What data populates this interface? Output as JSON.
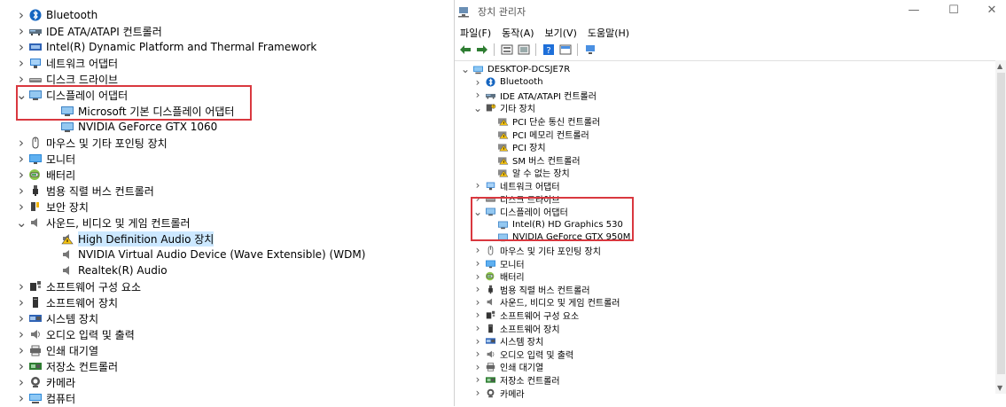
{
  "left": {
    "items": [
      {
        "chev": ">",
        "icon": "bluetooth-icon",
        "label": "Bluetooth",
        "level": 0
      },
      {
        "chev": ">",
        "icon": "drive-controller-icon",
        "label": "IDE ATA/ATAPI 컨트롤러",
        "level": 0
      },
      {
        "chev": ">",
        "icon": "chip-icon",
        "label": "Intel(R) Dynamic Platform and Thermal Framework",
        "level": 0
      },
      {
        "chev": ">",
        "icon": "network-icon",
        "label": "네트워크 어댑터",
        "level": 0
      },
      {
        "chev": ">",
        "icon": "disk-drive-icon",
        "label": "디스크 드라이브",
        "level": 0
      },
      {
        "chev": "v",
        "icon": "display-icon",
        "label": "디스플레이 어댑터",
        "level": 0
      },
      {
        "chev": "",
        "icon": "display-icon",
        "label": "Microsoft 기본 디스플레이 어댑터",
        "level": 1
      },
      {
        "chev": "",
        "icon": "display-icon",
        "label": "NVIDIA GeForce GTX 1060",
        "level": 1
      },
      {
        "chev": ">",
        "icon": "mouse-icon",
        "label": "마우스 및 기타 포인팅 장치",
        "level": 0
      },
      {
        "chev": ">",
        "icon": "monitor-icon",
        "label": "모니터",
        "level": 0
      },
      {
        "chev": ">",
        "icon": "battery-icon",
        "label": "배터리",
        "level": 0
      },
      {
        "chev": ">",
        "icon": "usb-icon",
        "label": "범용 직렬 버스 컨트롤러",
        "level": 0
      },
      {
        "chev": ">",
        "icon": "security-key-icon",
        "label": "보안 장치",
        "level": 0
      },
      {
        "chev": "v",
        "icon": "speaker-icon",
        "label": "사운드, 비디오 및 게임 컨트롤러",
        "level": 0
      },
      {
        "chev": "",
        "icon": "warning-speaker-icon",
        "label": "High Definition Audio 장치",
        "level": 1,
        "selected": true
      },
      {
        "chev": "",
        "icon": "speaker-icon",
        "label": "NVIDIA Virtual Audio Device (Wave Extensible) (WDM)",
        "level": 1
      },
      {
        "chev": "",
        "icon": "speaker-icon",
        "label": "Realtek(R) Audio",
        "level": 1
      },
      {
        "chev": ">",
        "icon": "software-component-icon",
        "label": "소프트웨어 구성 요소",
        "level": 0
      },
      {
        "chev": ">",
        "icon": "software-device-icon",
        "label": "소프트웨어 장치",
        "level": 0
      },
      {
        "chev": ">",
        "icon": "system-icon",
        "label": "시스템 장치",
        "level": 0
      },
      {
        "chev": ">",
        "icon": "audio-io-icon",
        "label": "오디오 입력 및 출력",
        "level": 0
      },
      {
        "chev": ">",
        "icon": "print-queue-icon",
        "label": "인쇄 대기열",
        "level": 0
      },
      {
        "chev": ">",
        "icon": "storage-controller-icon",
        "label": "저장소 컨트롤러",
        "level": 0
      },
      {
        "chev": ">",
        "icon": "camera-icon",
        "label": "카메라",
        "level": 0
      },
      {
        "chev": ">",
        "icon": "computer-icon",
        "label": "컴퓨터",
        "level": 0
      }
    ]
  },
  "right": {
    "window_title": "장치 관리자",
    "menu": [
      "파일(F)",
      "동작(A)",
      "보기(V)",
      "도움말(H)"
    ],
    "controls": {
      "minimize": "—",
      "maximize": "☐",
      "close": "✕"
    },
    "items": [
      {
        "chev": "v",
        "icon": "computer-icon",
        "label": "DESKTOP-DCSJE7R",
        "level": 0
      },
      {
        "chev": ">",
        "icon": "bluetooth-icon",
        "label": "Bluetooth",
        "level": 1
      },
      {
        "chev": ">",
        "icon": "drive-controller-icon",
        "label": "IDE ATA/ATAPI 컨트롤러",
        "level": 1
      },
      {
        "chev": "v",
        "icon": "other-devices-icon",
        "label": "기타 장치",
        "level": 1
      },
      {
        "chev": "",
        "icon": "warning-device-icon",
        "label": "PCI 단순 통신 컨트롤러",
        "level": 2
      },
      {
        "chev": "",
        "icon": "warning-device-icon",
        "label": "PCI 메모리 컨트롤러",
        "level": 2
      },
      {
        "chev": "",
        "icon": "warning-device-icon",
        "label": "PCI 장치",
        "level": 2
      },
      {
        "chev": "",
        "icon": "warning-device-icon",
        "label": "SM 버스 컨트롤러",
        "level": 2
      },
      {
        "chev": "",
        "icon": "warning-device-icon",
        "label": "알 수 없는 장치",
        "level": 2
      },
      {
        "chev": ">",
        "icon": "network-icon",
        "label": "네트워크 어댑터",
        "level": 1
      },
      {
        "chev": ">",
        "icon": "disk-drive-icon",
        "label": "디스크 드라이브",
        "level": 1
      },
      {
        "chev": "v",
        "icon": "display-icon",
        "label": "디스플레이 어댑터",
        "level": 1
      },
      {
        "chev": "",
        "icon": "display-icon",
        "label": "Intel(R) HD Graphics 530",
        "level": 2
      },
      {
        "chev": "",
        "icon": "display-icon",
        "label": "NVIDIA GeForce GTX 950M",
        "level": 2
      },
      {
        "chev": ">",
        "icon": "mouse-icon",
        "label": "마우스 및 기타 포인팅 장치",
        "level": 1
      },
      {
        "chev": ">",
        "icon": "monitor-icon",
        "label": "모니터",
        "level": 1
      },
      {
        "chev": ">",
        "icon": "battery-icon",
        "label": "배터리",
        "level": 1
      },
      {
        "chev": ">",
        "icon": "usb-icon",
        "label": "범용 직렬 버스 컨트롤러",
        "level": 1
      },
      {
        "chev": ">",
        "icon": "speaker-icon",
        "label": "사운드, 비디오 및 게임 컨트롤러",
        "level": 1
      },
      {
        "chev": ">",
        "icon": "software-component-icon",
        "label": "소프트웨어 구성 요소",
        "level": 1
      },
      {
        "chev": ">",
        "icon": "software-device-icon",
        "label": "소프트웨어 장치",
        "level": 1
      },
      {
        "chev": ">",
        "icon": "system-icon",
        "label": "시스템 장치",
        "level": 1
      },
      {
        "chev": ">",
        "icon": "audio-io-icon",
        "label": "오디오 입력 및 출력",
        "level": 1
      },
      {
        "chev": ">",
        "icon": "print-queue-icon",
        "label": "인쇄 대기열",
        "level": 1
      },
      {
        "chev": ">",
        "icon": "storage-controller-icon",
        "label": "저장소 컨트롤러",
        "level": 1
      },
      {
        "chev": ">",
        "icon": "camera-icon",
        "label": "카메라",
        "level": 1
      }
    ]
  },
  "colors": {
    "highlight_box": "#d9383f",
    "selected_bg": "#cce8ff",
    "accent_blue": "#1e88e5"
  }
}
